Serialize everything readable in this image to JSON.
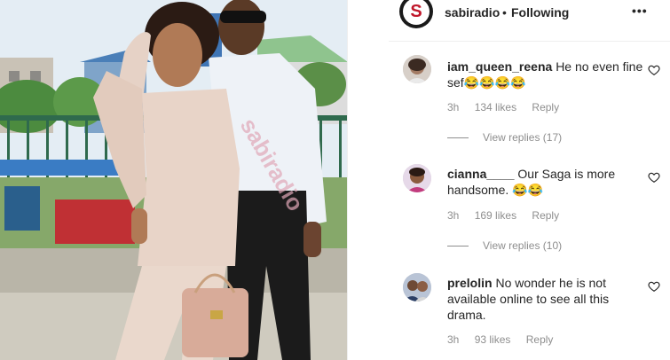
{
  "post": {
    "username": "sabiradio",
    "separator": "•",
    "follow_status": "Following",
    "more_icon": "more-horizontal-icon",
    "photo_watermark": "sabiradio",
    "brand_color": "#c0182b"
  },
  "comments": [
    {
      "username": "iam_queen_reena",
      "text": "He no even fine sef😂😂😂😂",
      "time": "3h",
      "likes": "134 likes",
      "reply": "Reply",
      "view_replies": "View replies (17)"
    },
    {
      "username": "cianna____",
      "text": "Our Saga is more handsome. 😂😂",
      "time": "3h",
      "likes": "169 likes",
      "reply": "Reply",
      "view_replies": "View replies (10)"
    },
    {
      "username": "prelolin",
      "text": "No wonder he is not available online to see all this drama.",
      "time": "3h",
      "likes": "93 likes",
      "reply": "Reply"
    }
  ]
}
